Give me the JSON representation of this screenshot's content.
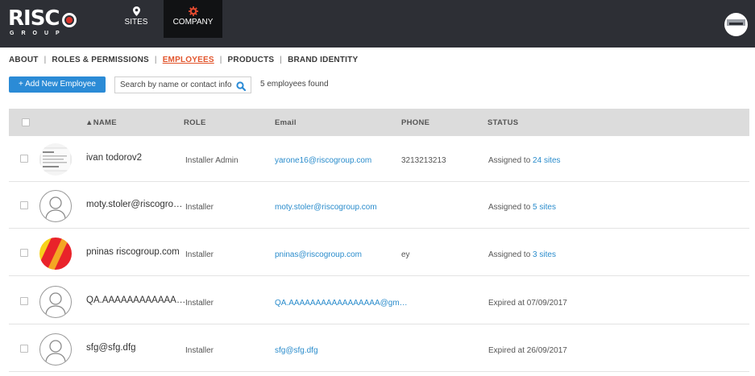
{
  "brand": {
    "logo_main": "RISC",
    "logo_sub": "GROUP"
  },
  "topnav": {
    "sites": {
      "label": "SITES",
      "icon": "map-pin-icon"
    },
    "company": {
      "label": "COMPANY",
      "icon": "gear-icon",
      "accent": "#e24a30"
    }
  },
  "subnav": {
    "about": "ABOUT",
    "roles": "ROLES & PERMISSIONS",
    "employees": "EMPLOYEES",
    "products": "PRODUCTS",
    "brand_identity": "BRAND IDENTITY",
    "separator": "|"
  },
  "toolbar": {
    "add_label": "+ Add New Employee",
    "search_placeholder": "Search by name or contact info",
    "found_text": "5 employees found"
  },
  "table": {
    "headers": {
      "name": "▲NAME",
      "role": "ROLE",
      "email": "Email",
      "phone": "PHONE",
      "status": "STATUS"
    },
    "rows": [
      {
        "name": "ivan todorov2",
        "role": "Installer Admin",
        "email": "yarone16@riscogroup.com",
        "phone": "3213213213",
        "status_prefix": "Assigned to ",
        "status_link": "24 sites",
        "avatar": "document-thumbnail"
      },
      {
        "name": "moty.stoler@riscogroup.com",
        "role": "Installer",
        "email": "moty.stoler@riscogroup.com",
        "phone": "",
        "status_prefix": "Assigned to ",
        "status_link": "5 sites",
        "avatar": "default-user"
      },
      {
        "name": "pninas riscogroup.com",
        "role": "Installer",
        "email": "pninas@riscogroup.com",
        "phone": "ey",
        "status_prefix": "Assigned to ",
        "status_link": "3 sites",
        "avatar": "colorful-photo"
      },
      {
        "name": "QA.AAAAAAAAAAAAAAAA",
        "role": "Installer",
        "email": "QA.AAAAAAAAAAAAAAAAA@gmail.com",
        "phone": "",
        "status_prefix": "Expired at 07/09/2017",
        "status_link": "",
        "avatar": "default-user"
      },
      {
        "name": "sfg@sfg.dfg",
        "role": "Installer",
        "email": "sfg@sfg.dfg",
        "phone": "",
        "status_prefix": "Expired at 26/09/2017",
        "status_link": "",
        "avatar": "default-user"
      }
    ]
  },
  "colors": {
    "topbar": "#2d2f35",
    "active_nav": "#111214",
    "accent_orange": "#e2552c",
    "primary_blue": "#2b8bd6",
    "link_blue": "#2a8ccc"
  }
}
